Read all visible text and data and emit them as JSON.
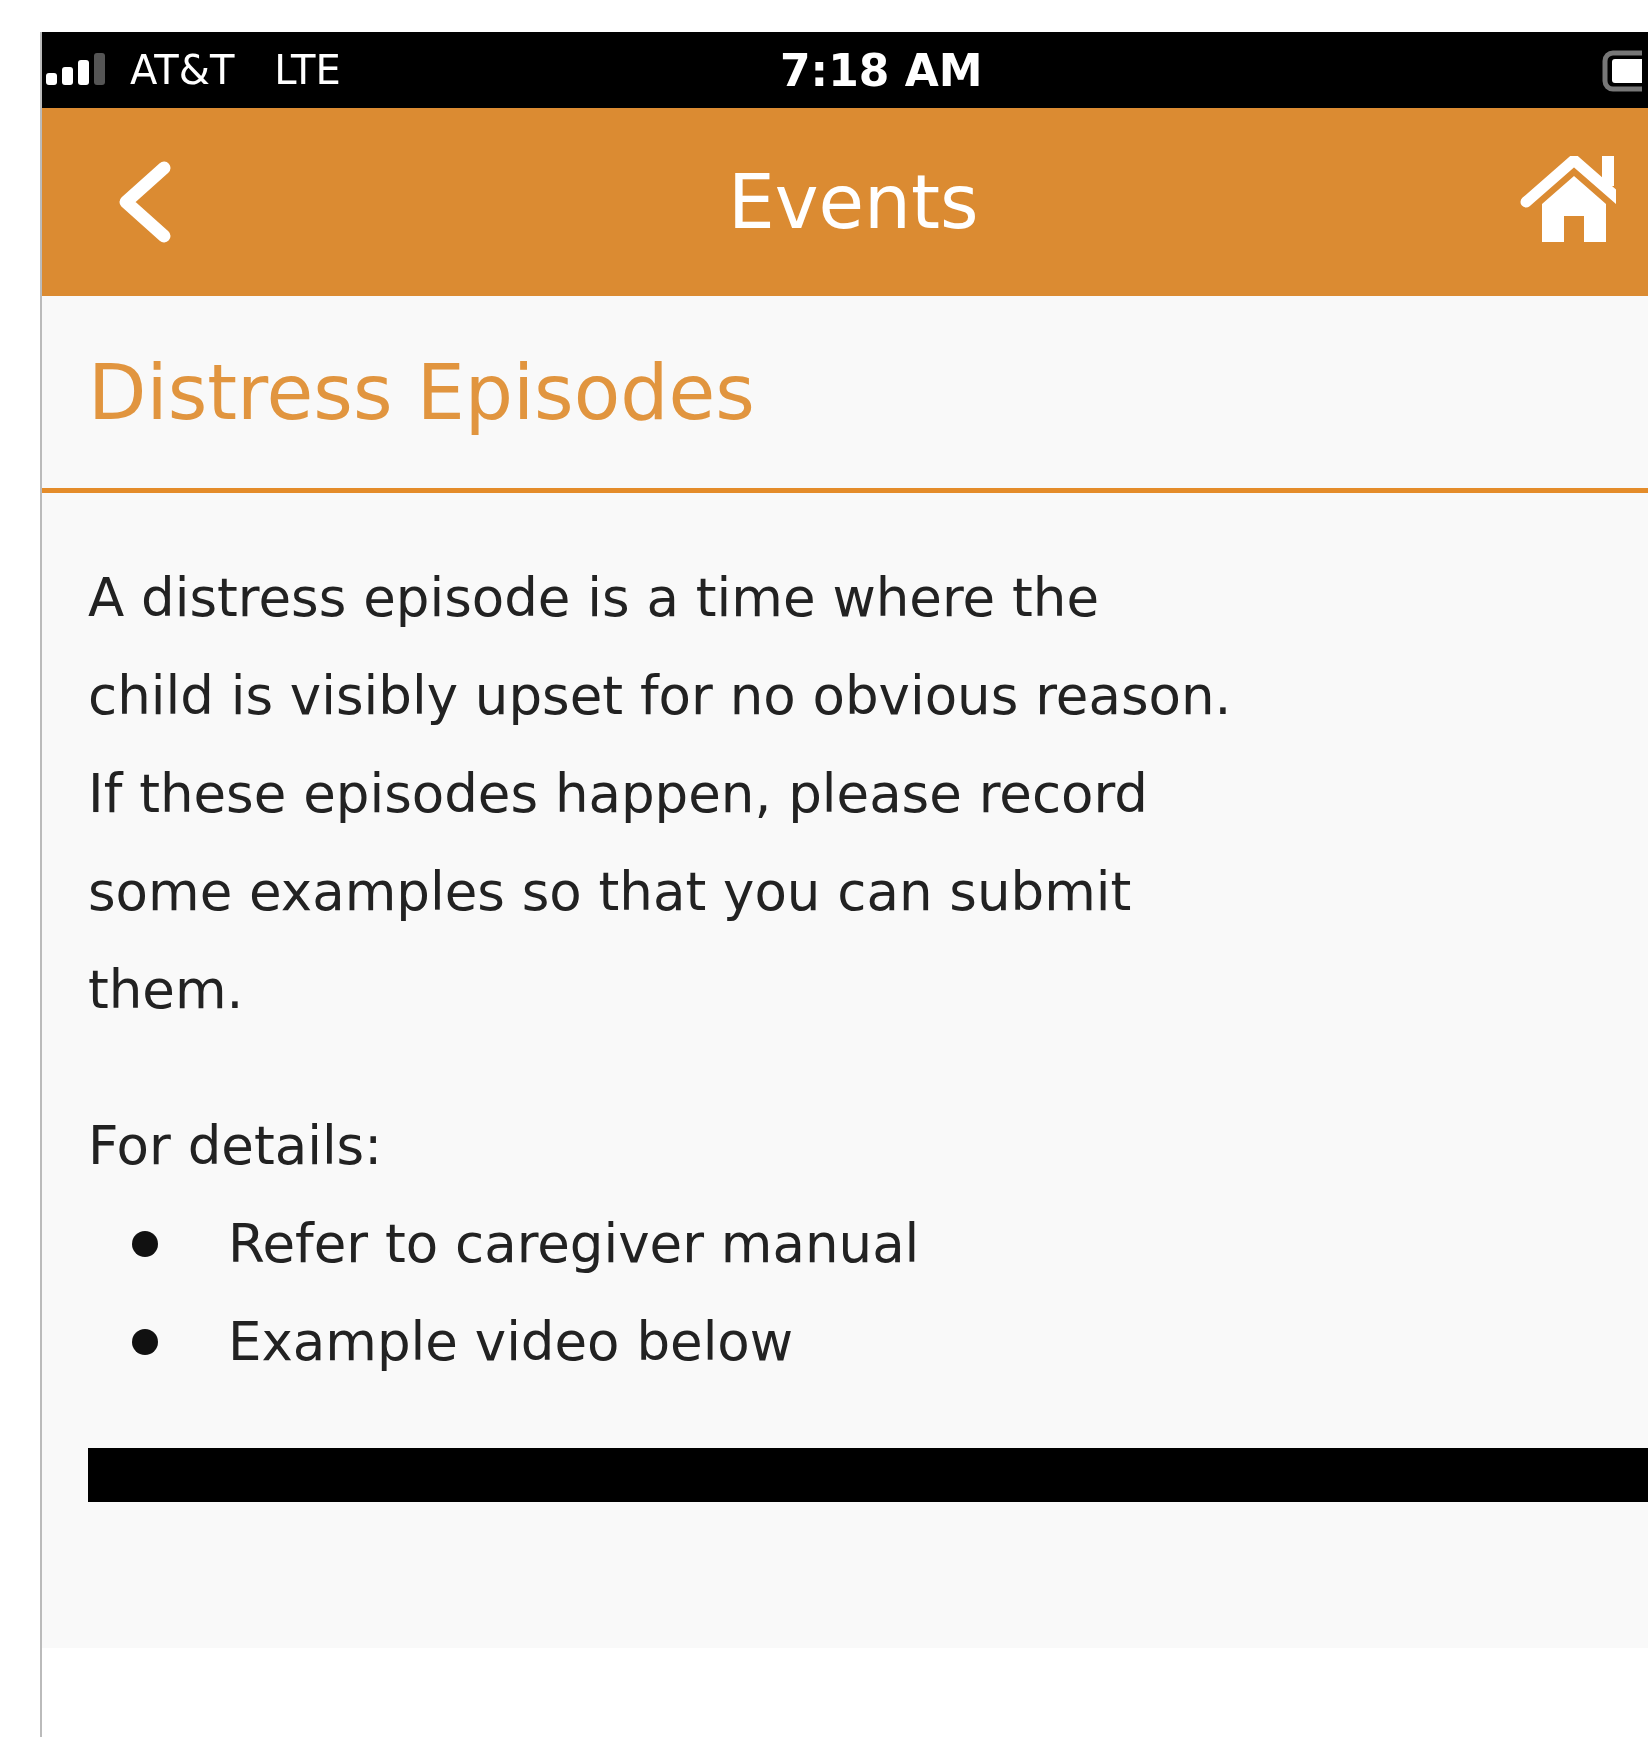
{
  "status_bar": {
    "carrier": "AT&T",
    "network": "LTE",
    "time": "7:18 AM"
  },
  "nav_bar": {
    "title": "Events"
  },
  "heading": "Distress Episodes",
  "description": "A distress episode is a time where the\nchild is visibly upset for no obvious reason.\nIf these episodes happen, please record\nsome examples so that you can submit\nthem.",
  "details": {
    "label": "For details:",
    "items": [
      "Refer to caregiver manual",
      "Example video below"
    ]
  }
}
